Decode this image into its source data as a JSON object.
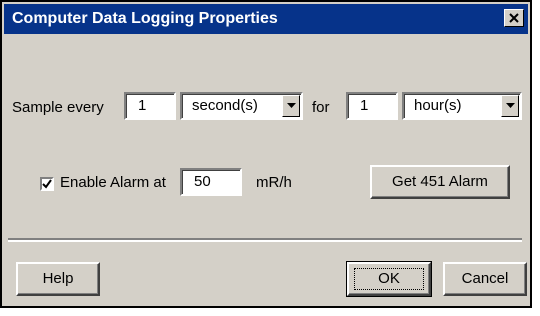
{
  "dialog": {
    "title": "Computer Data Logging Properties"
  },
  "sample": {
    "label": "Sample every",
    "interval_value": "1",
    "interval_unit": "second(s)",
    "for_label": "for",
    "duration_value": "1",
    "duration_unit": "hour(s)"
  },
  "alarm": {
    "checkbox_label": "Enable Alarm at",
    "checked": true,
    "value": "50",
    "unit": "mR/h",
    "get_button": "Get 451 Alarm"
  },
  "buttons": {
    "help": "Help",
    "ok": "OK",
    "cancel": "Cancel"
  },
  "colors": {
    "titlebar": "#06338a",
    "dialog_bg": "#d4d0c8"
  }
}
